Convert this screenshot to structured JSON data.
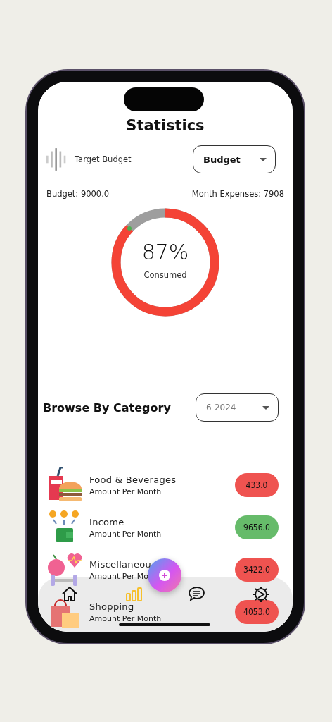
{
  "title": "Statistics",
  "target": {
    "label": "Target Budget",
    "dropdown": "Budget"
  },
  "budget_label": "Budget: 9000.0",
  "expenses_label": "Month Expenses: 7908",
  "gauge": {
    "level": 0.87,
    "percent": "87%",
    "caption": "Consumed"
  },
  "browse": {
    "heading": "Browse By Category",
    "dropdown": "6-2024"
  },
  "categories": [
    {
      "kind": "food",
      "name": "Food & Beverages",
      "sub": "Amount Per Month",
      "amount": "433.0",
      "color": "#ef5350"
    },
    {
      "kind": "income",
      "name": "Income",
      "sub": "Amount Per Month",
      "amount": "9656.0",
      "color": "#66bb6a"
    },
    {
      "kind": "misc",
      "name": "Miscellaneou",
      "sub": "Amount Per Mo",
      "amount": "3422.0",
      "color": "#ef5350"
    },
    {
      "kind": "shopping",
      "name": "Shopping",
      "sub": "Amount Per Month",
      "amount": "4053.0",
      "color": "#ef5350"
    }
  ],
  "nav": [
    {
      "kind": "home",
      "selected": false
    },
    {
      "kind": "chart",
      "selected": true
    },
    {
      "kind": "chat",
      "selected": false
    },
    {
      "kind": "settings",
      "selected": false
    }
  ]
}
